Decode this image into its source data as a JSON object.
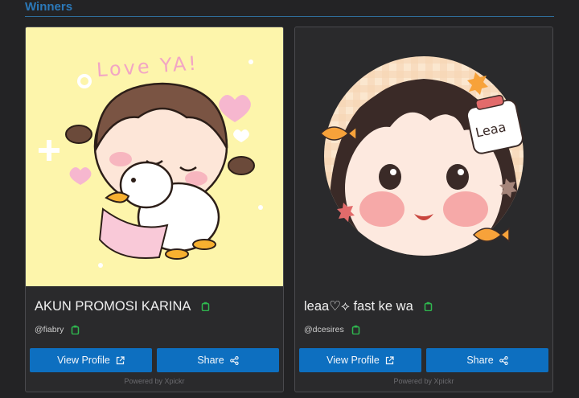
{
  "section": {
    "title": "Winners"
  },
  "colors": {
    "accent": "#0d6fc0",
    "header": "#2b78b8",
    "copy_icon": "#2fb84f",
    "card_bg": "#2a2a2c"
  },
  "cards": [
    {
      "name": "AKUN PROMOSI KARINA",
      "handle": "@fiabry",
      "image_text": "Love YA!",
      "view_label": "View Profile",
      "share_label": "Share",
      "powered_by": "Powered by Xpickr"
    },
    {
      "name": "leaa♡⟡ fast ke wa",
      "handle": "@dcesires",
      "image_text": "Leaa",
      "view_label": "View Profile",
      "share_label": "Share",
      "powered_by": "Powered by Xpickr"
    }
  ]
}
